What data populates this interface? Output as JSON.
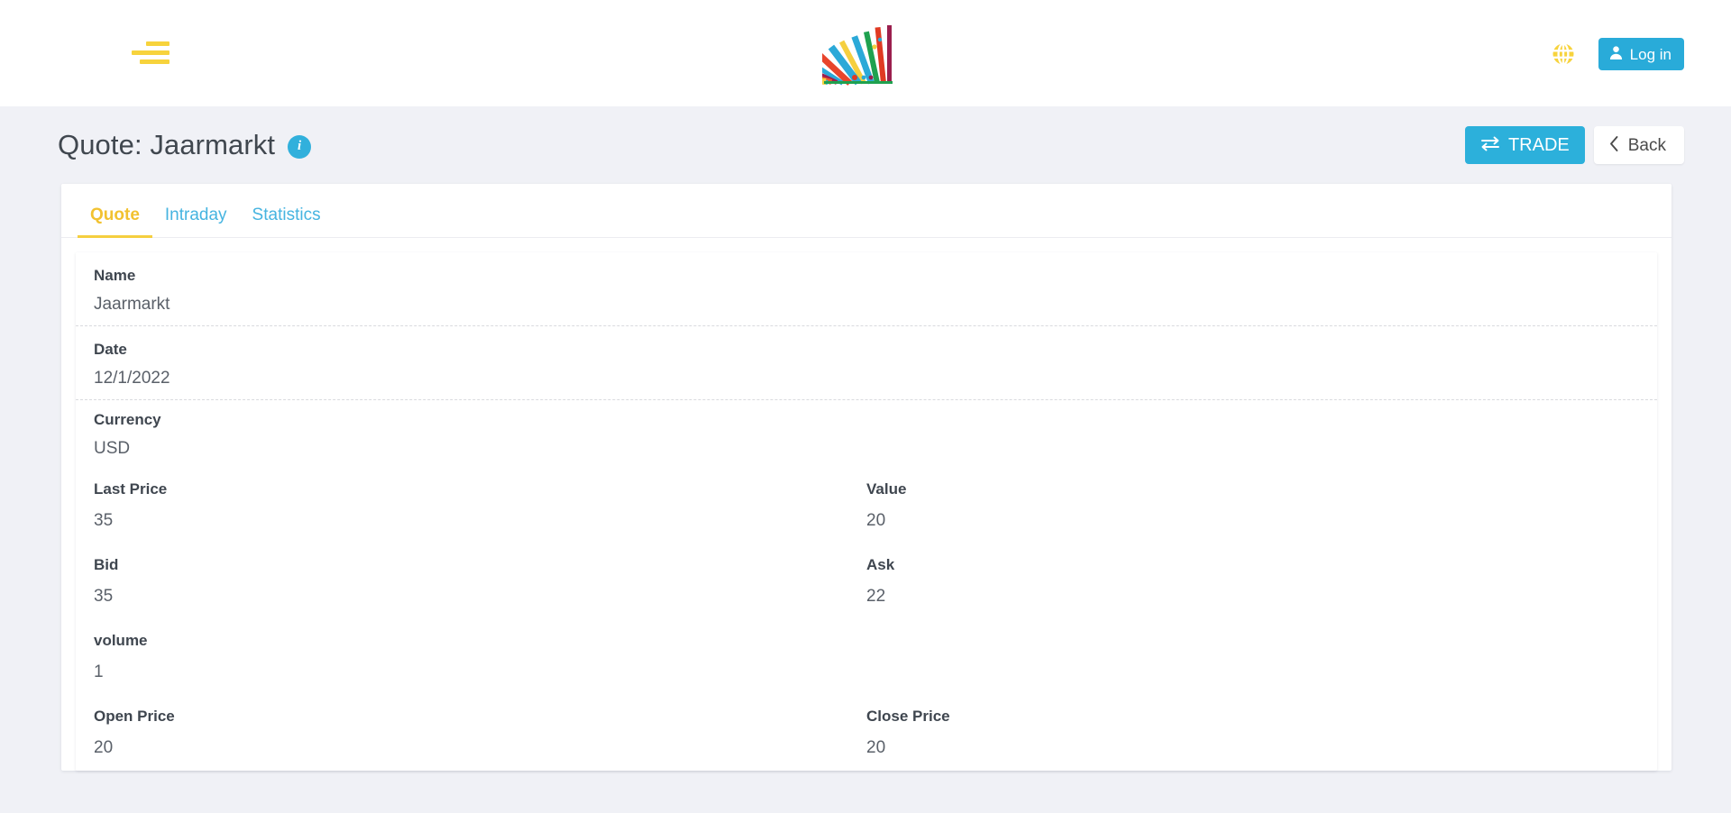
{
  "header": {
    "menu_icon": "hamburger-menu-icon",
    "logo_alt": "books-fan-logo",
    "language_icon": "globe-icon",
    "login_label": "Log in",
    "login_icon": "user-icon",
    "colors": {
      "accent_yellow": "#f7d33c",
      "accent_cyan": "#29abd9",
      "page_bg": "#f0f1f6"
    }
  },
  "page": {
    "title": "Quote: Jaarmarkt",
    "info_icon": "info-circle-icon",
    "info_glyph": "i",
    "actions": {
      "trade_label": "TRADE",
      "trade_icon": "exchange-arrows-icon",
      "back_label": "Back",
      "back_icon": "chevron-left-icon"
    }
  },
  "tabs": [
    {
      "label": "Quote",
      "active": true
    },
    {
      "label": "Intraday",
      "active": false
    },
    {
      "label": "Statistics",
      "active": false
    }
  ],
  "quote": {
    "name": {
      "label": "Name",
      "value": "Jaarmarkt"
    },
    "date": {
      "label": "Date",
      "value": "12/1/2022"
    },
    "currency": {
      "label": "Currency",
      "value": "USD"
    },
    "last_price": {
      "label": "Last Price",
      "value": "35"
    },
    "value": {
      "label": "Value",
      "value": "20"
    },
    "bid": {
      "label": "Bid",
      "value": "35"
    },
    "ask": {
      "label": "Ask",
      "value": "22"
    },
    "volume": {
      "label": "volume",
      "value": "1"
    },
    "open_price": {
      "label": "Open Price",
      "value": "20"
    },
    "close_price": {
      "label": "Close Price",
      "value": "20"
    }
  }
}
